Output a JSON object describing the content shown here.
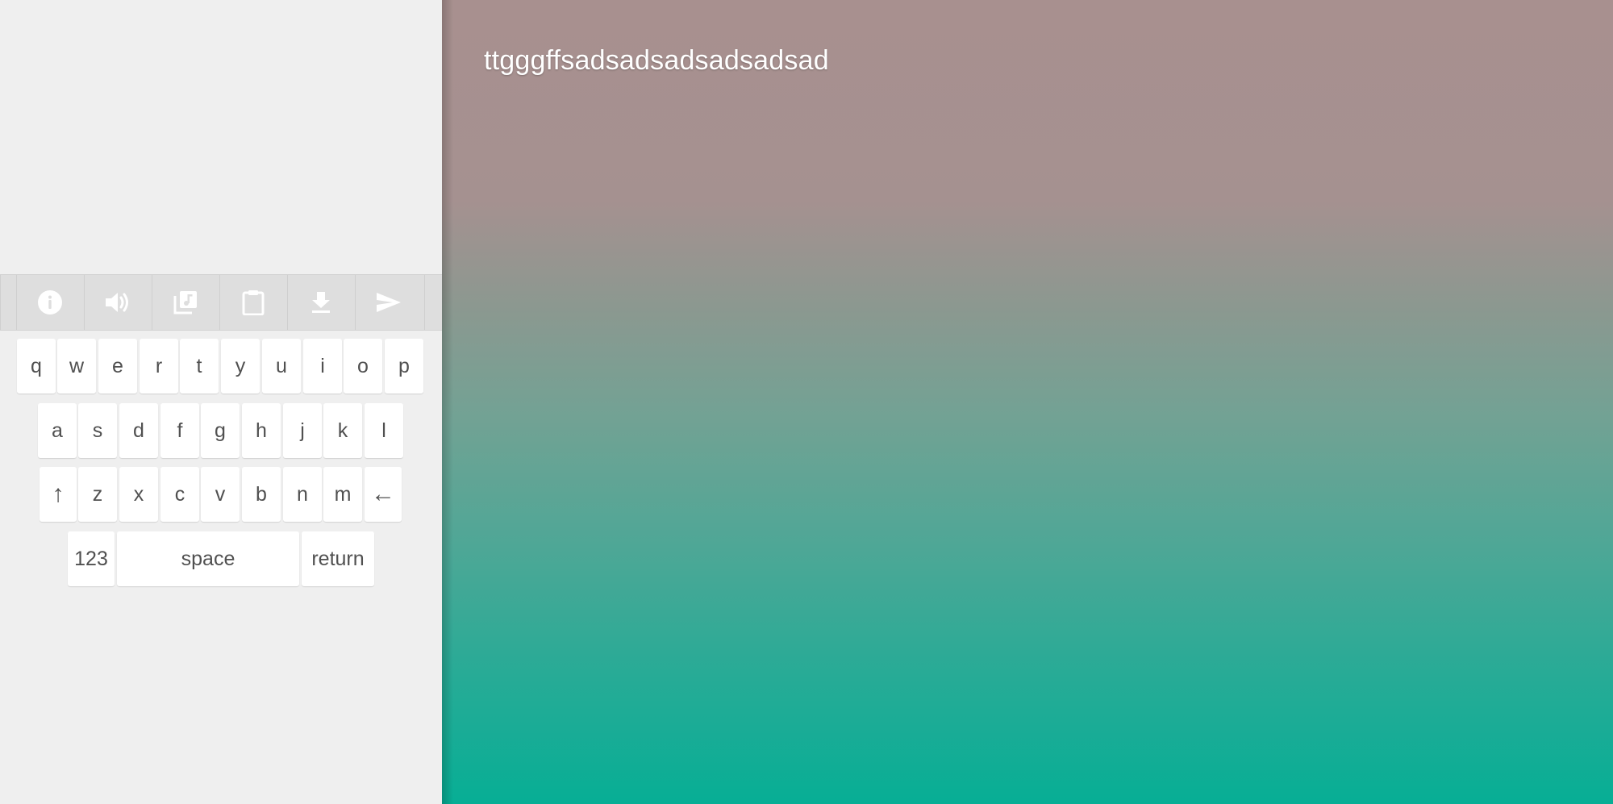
{
  "toolbar": {
    "buttons": [
      {
        "name": "info-icon"
      },
      {
        "name": "speaker-icon"
      },
      {
        "name": "music-library-icon"
      },
      {
        "name": "clipboard-icon"
      },
      {
        "name": "download-icon"
      },
      {
        "name": "send-icon"
      }
    ]
  },
  "keyboard": {
    "row1": [
      "q",
      "w",
      "e",
      "r",
      "t",
      "y",
      "u",
      "i",
      "o",
      "p"
    ],
    "row2": [
      "a",
      "s",
      "d",
      "f",
      "g",
      "h",
      "j",
      "k",
      "l"
    ],
    "row3": {
      "shift": "↑",
      "letters": [
        "z",
        "x",
        "c",
        "v",
        "b",
        "n",
        "m"
      ],
      "backspace": "←"
    },
    "row4": {
      "numbers": "123",
      "space": "space",
      "return": "return"
    }
  },
  "editor": {
    "text": "ttgggffsadsadsadsadsadsad"
  },
  "colors": {
    "panel_bg": "#efefef",
    "toolbar_bg": "#dedede",
    "icon": "#ffffff",
    "key_text": "#505050",
    "gradient_top": "#a8908f",
    "gradient_bottom": "#07ae95"
  }
}
